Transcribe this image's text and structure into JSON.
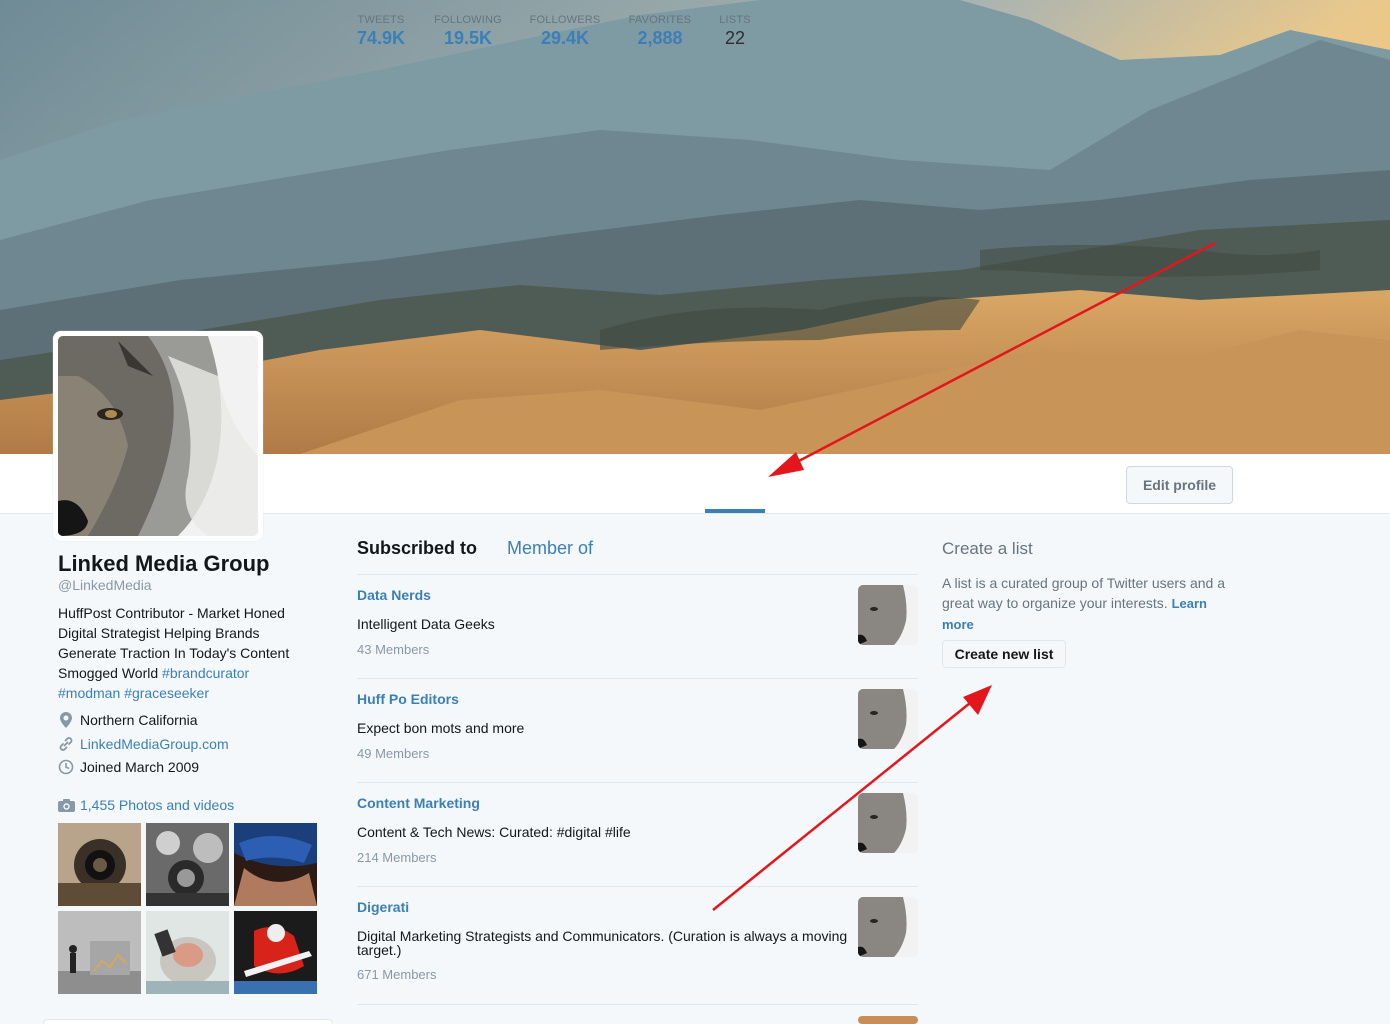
{
  "colors": {
    "link": "#3b7fb8",
    "arrow": "#e3161b"
  },
  "stats": [
    {
      "label": "TWEETS",
      "value": "74.9K"
    },
    {
      "label": "FOLLOWING",
      "value": "19.5K"
    },
    {
      "label": "FOLLOWERS",
      "value": "29.4K"
    },
    {
      "label": "FAVORITES",
      "value": "2,888"
    },
    {
      "label": "LISTS",
      "value": "22",
      "active": true
    }
  ],
  "edit_profile_label": "Edit profile",
  "profile": {
    "name": "Linked Media Group",
    "handle": "@LinkedMedia",
    "bio_text": "HuffPost Contributor - Market Honed Digital Strategist Helping Brands Generate Traction In Today's Content Smogged World",
    "bio_tags": [
      "#brandcurator",
      "#modman",
      "#graceseeker"
    ],
    "location": "Northern California",
    "website": "LinkedMediaGroup.com",
    "joined": "Joined March 2009",
    "photos_link": "1,455 Photos and videos"
  },
  "tabs": {
    "subscribed": "Subscribed to",
    "member_of": "Member of"
  },
  "lists": [
    {
      "name": "Data Nerds",
      "description": "Intelligent Data Geeks",
      "members": "43 Members"
    },
    {
      "name": "Huff Po Editors",
      "description": "Expect bon mots and more",
      "members": "49 Members"
    },
    {
      "name": "Content Marketing",
      "description": "Content & Tech News: Curated: #digital #life",
      "members": "214 Members"
    },
    {
      "name": "Digerati",
      "description": "Digital Marketing Strategists and Communicators. (Curation is always a moving target.)",
      "members": "671 Members"
    }
  ],
  "create_list": {
    "title": "Create a list",
    "description": "A list is a curated group of Twitter users and a great way to organize your interests.",
    "learn_more": "Learn more",
    "button": "Create new list"
  }
}
